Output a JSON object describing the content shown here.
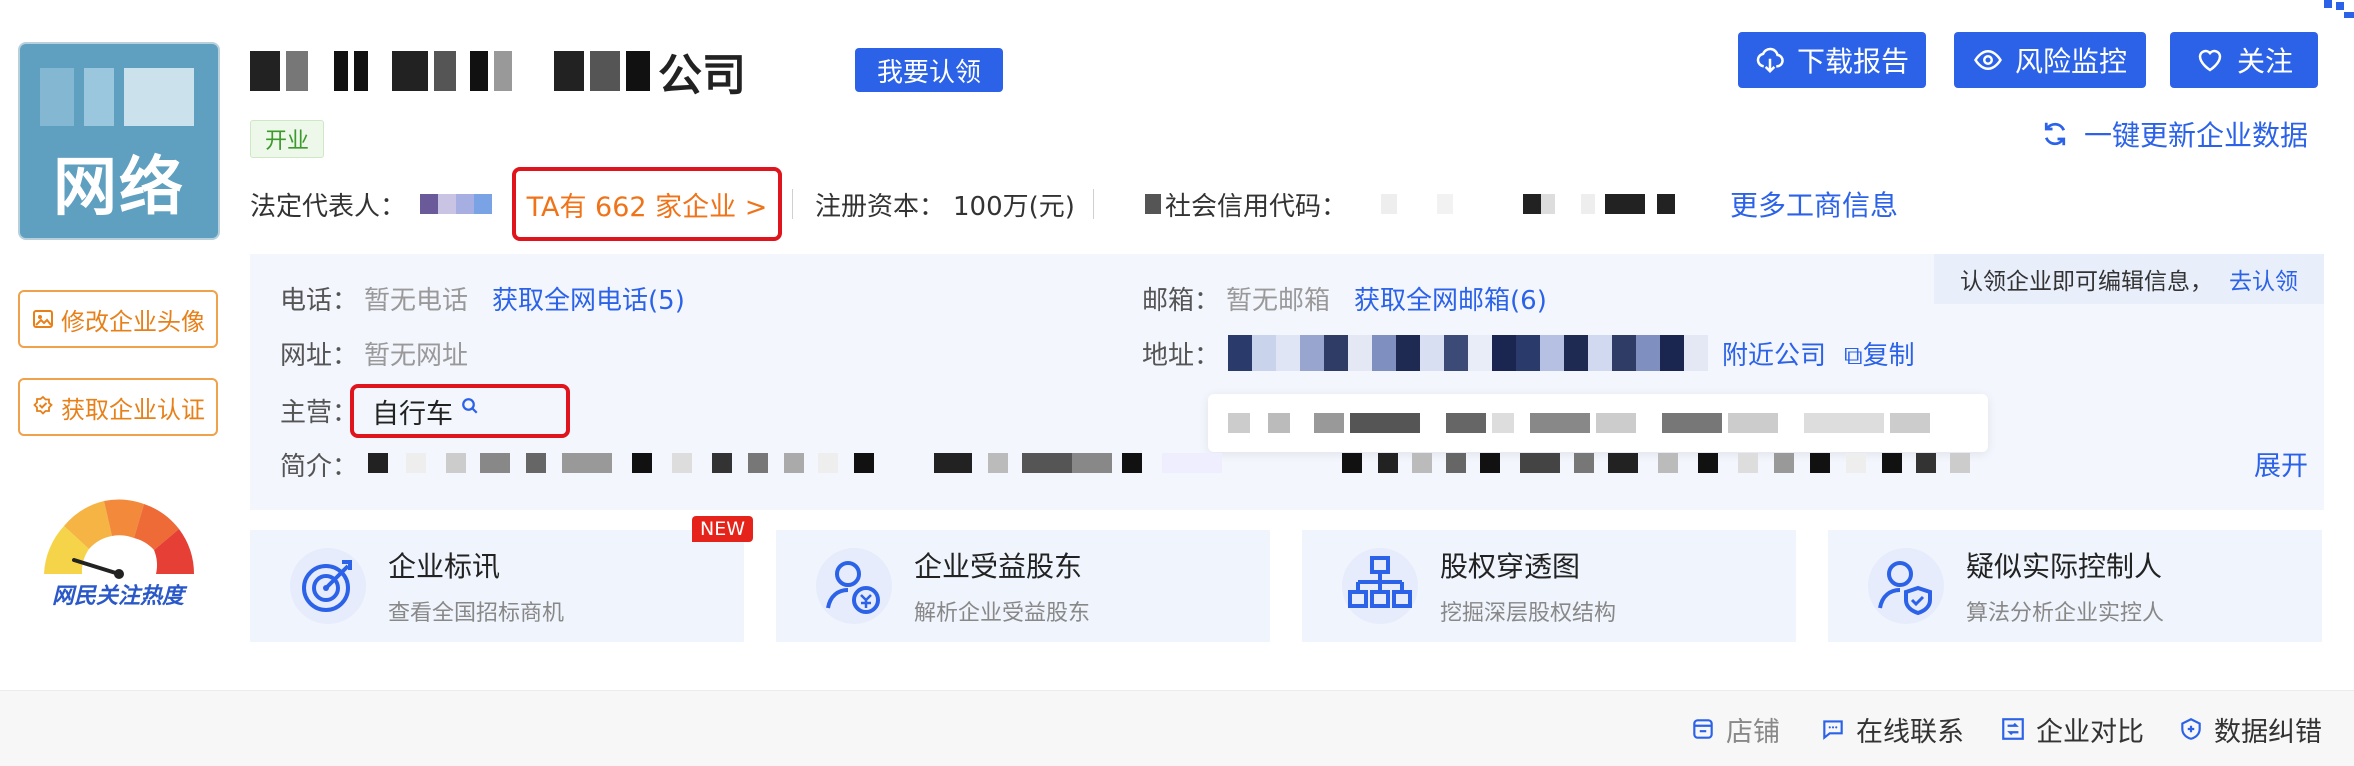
{
  "logo": {
    "text": "网络"
  },
  "company": {
    "name_suffix": "公司",
    "claim_label": "我要认领",
    "status": "开业"
  },
  "sidebar": {
    "edit_avatar_label": "修改企业头像",
    "get_cert_label": "获取企业认证",
    "heat_label": "网民关注热度"
  },
  "actions": {
    "download_label": "下载报告",
    "monitor_label": "风险监控",
    "follow_label": "关注",
    "refresh_label": "一键更新企业数据"
  },
  "info": {
    "legal_rep_label": "法定代表人：",
    "ta_companies": "TA有 662 家企业 >",
    "capital_label": "注册资本：",
    "capital_value": "100万(元)",
    "credit_label": "社会信用代码：",
    "more_link": "更多工商信息"
  },
  "panel": {
    "hint_text": "认领企业即可编辑信息，",
    "hint_link": "去认领",
    "phone_label": "电话：",
    "phone_value": "暂无电话",
    "phone_link": "获取全网电话(5)",
    "email_label": "邮箱：",
    "email_value": "暂无邮箱",
    "email_link": "获取全网邮箱(6)",
    "website_label": "网址：",
    "website_value": "暂无网址",
    "address_label": "地址：",
    "nearby_link": "附近公司",
    "copy_link": "复制",
    "main_label": "主营：",
    "main_value": "自行车",
    "intro_label": "简介：",
    "expand_link": "展开"
  },
  "cards": [
    {
      "title": "企业标讯",
      "subtitle": "查看全国招标商机",
      "badge": "NEW",
      "icon": "target-icon"
    },
    {
      "title": "企业受益股东",
      "subtitle": "解析企业受益股东",
      "icon": "beneficiary-icon"
    },
    {
      "title": "股权穿透图",
      "subtitle": "挖掘深层股权结构",
      "icon": "org-chart-icon"
    },
    {
      "title": "疑似实际控制人",
      "subtitle": "算法分析企业实控人",
      "icon": "controller-icon"
    }
  ],
  "bottom": {
    "shop": "店铺",
    "contact": "在线联系",
    "compare": "企业对比",
    "correct": "数据纠错"
  },
  "colors": {
    "primary": "#2b62e8",
    "highlight": "#e0141c",
    "orange": "#f07319"
  }
}
